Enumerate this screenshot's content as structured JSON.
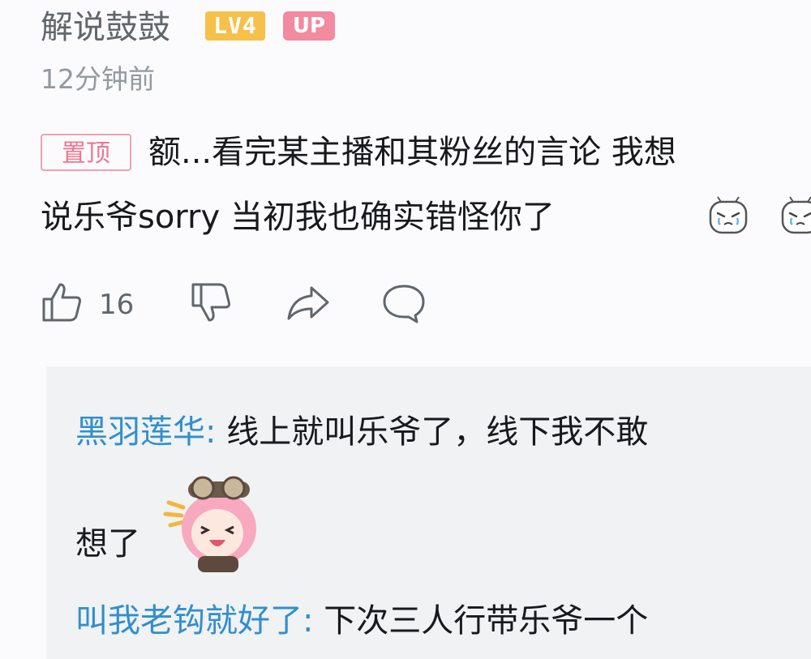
{
  "comment": {
    "username": "解说鼓鼓",
    "level_badge": "LV4",
    "up_badge": "UP",
    "time": "12分钟前",
    "pinned_label": "置顶",
    "text_line1": "额...看完某主播和其粉丝的言论 我想",
    "text_line2": "说乐爷sorry 当初我也确实错怪你了",
    "emotes": [
      "crying-emoji-icon",
      "crying-emoji-icon"
    ],
    "actions": {
      "like_count": "16"
    }
  },
  "replies": [
    {
      "user": "黑羽莲华",
      "separator": ":",
      "text_part1": " 线上就叫乐爷了，线下我不敢",
      "text_part2": "想了",
      "sticker": "laughing-anime-girl-sticker"
    },
    {
      "user": "叫我老钩就好了",
      "separator": ":",
      "text": " 下次三人行带乐爷一个"
    }
  ],
  "colors": {
    "username": "#61666d",
    "level_badge": "#f6c04a",
    "up_badge": "#f28aa0",
    "pin_border": "#f3a0b0",
    "reply_user": "#2f8fcf",
    "reply_bg": "#f1f2f3"
  }
}
